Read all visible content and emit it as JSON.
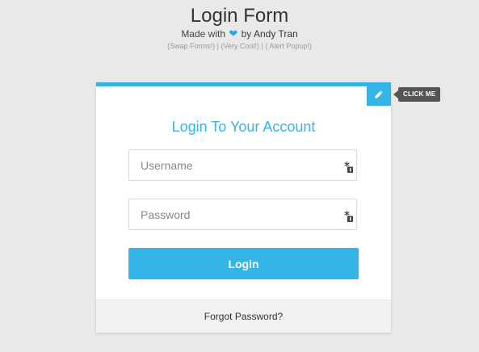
{
  "header": {
    "title": "Login Form",
    "made_with": "Made with",
    "by": "by",
    "author": "Andy Tran",
    "links": [
      "(Swap Forms!)",
      "(Very Cool!)",
      "( Alert Popup!)"
    ],
    "link_separator": " | "
  },
  "toggle": {
    "icon": "pencil-icon",
    "tooltip": "CLICK ME"
  },
  "form": {
    "title": "Login To Your Account",
    "username_placeholder": "Username",
    "username_value": "",
    "password_placeholder": "Password",
    "password_value": "",
    "field_icon": "key-icon",
    "submit_label": "Login"
  },
  "footer": {
    "forgot_label": "Forgot Password?"
  },
  "colors": {
    "accent": "#33b5e5",
    "background": "#e9e9e9",
    "heart": "#29a8df",
    "tooltip_bg": "#555555"
  }
}
